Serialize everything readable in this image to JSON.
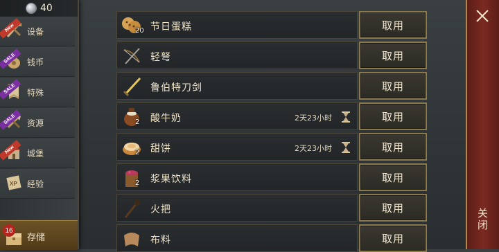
{
  "currency": {
    "icon": "silver-gem-icon",
    "amount": "40"
  },
  "sidebar": {
    "items": [
      {
        "label": "设备",
        "icon": "weapons-icon",
        "ribbon": "New"
      },
      {
        "label": "钱币",
        "icon": "coin-bag-icon",
        "ribbon": "SALE"
      },
      {
        "label": "特殊",
        "icon": "banner-icon",
        "ribbon": "SALE"
      },
      {
        "label": "资源",
        "icon": "tools-icon",
        "ribbon": "SALE"
      },
      {
        "label": "城堡",
        "icon": "castle-icon",
        "ribbon": "New"
      },
      {
        "label": "经验",
        "icon": "xp-scroll-icon",
        "ribbon": ""
      }
    ],
    "storage": {
      "label": "存储",
      "count": "16",
      "icon": "storage-chest-icon"
    }
  },
  "items": [
    {
      "name": "节日蛋糕",
      "qty": "20",
      "timer": "",
      "icon": "cookies-icon",
      "button": "取用"
    },
    {
      "name": "轻弩",
      "qty": "",
      "timer": "",
      "icon": "crossbow-icon",
      "button": "取用"
    },
    {
      "name": "鲁伯特刀剑",
      "qty": "",
      "timer": "",
      "icon": "sword-icon",
      "button": "取用"
    },
    {
      "name": "酸牛奶",
      "qty": "2",
      "timer": "2天23小时",
      "icon": "yogurt-pot-icon",
      "button": "取用"
    },
    {
      "name": "甜饼",
      "qty": "2",
      "timer": "2天23小时",
      "icon": "pie-icon",
      "button": "取用"
    },
    {
      "name": "浆果饮料",
      "qty": "2",
      "timer": "",
      "icon": "berry-drink-icon",
      "button": "取用"
    },
    {
      "name": "火把",
      "qty": "",
      "timer": "",
      "icon": "torch-icon",
      "button": "取用"
    },
    {
      "name": "布料",
      "qty": "",
      "timer": "",
      "icon": "cloth-icon",
      "button": "取用"
    }
  ],
  "close": {
    "label": "关闭"
  },
  "colors": {
    "accent_gold": "#8c7a4f",
    "close_red": "#7a2a21",
    "new_ribbon": "#c0392b",
    "sale_ribbon": "#7b2fa3"
  }
}
